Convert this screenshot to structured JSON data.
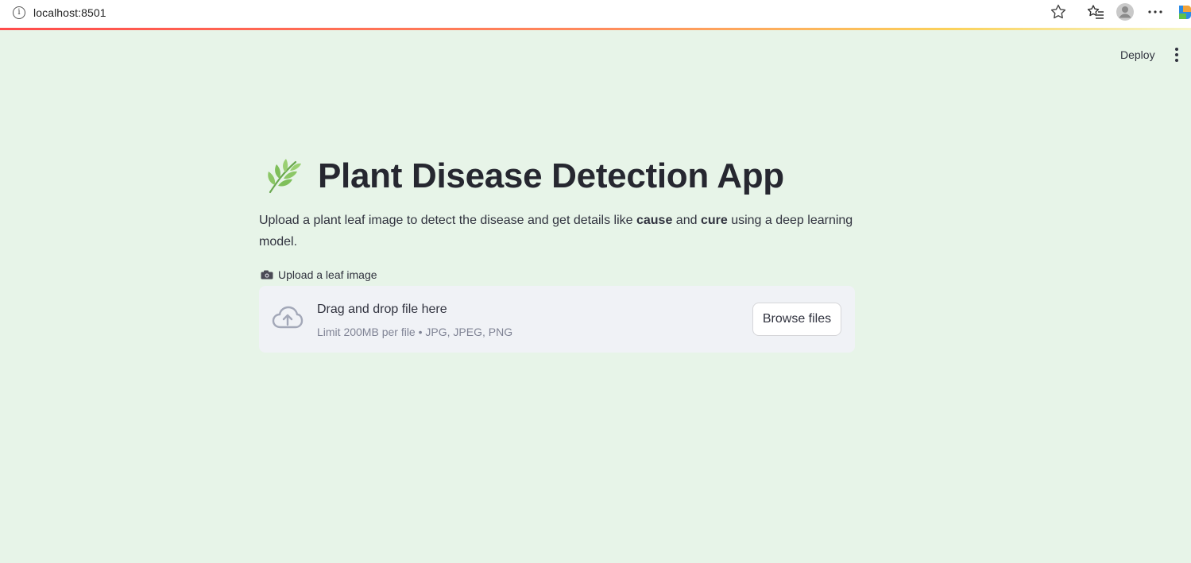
{
  "browser": {
    "url": "localhost:8501",
    "icons": [
      "info-icon",
      "star-icon",
      "favorites-icon",
      "profile-icon",
      "more-icon",
      "copilot-icon"
    ]
  },
  "header": {
    "deploy_label": "Deploy",
    "menu_icon": "kebab-icon"
  },
  "main": {
    "title": "Plant Disease Detection App",
    "title_icon": "herb-icon",
    "description": {
      "part1": "Upload a plant leaf image to detect the disease and get details like ",
      "bold1": "cause",
      "part2": " and ",
      "bold2": "cure",
      "part3": " using a deep learning model."
    },
    "uploader": {
      "label_icon": "camera-icon",
      "label": "Upload a leaf image",
      "drop_title": "Drag and drop file here",
      "limit_text": "Limit 200MB per file • JPG, JPEG, PNG",
      "browse_label": "Browse files",
      "icon": "cloud-upload-icon"
    }
  },
  "colors": {
    "background": "#e7f4e8",
    "dropzone": "#f0f2f6",
    "text": "#31333f",
    "muted": "#808495",
    "accent": "#ff4b4b"
  }
}
